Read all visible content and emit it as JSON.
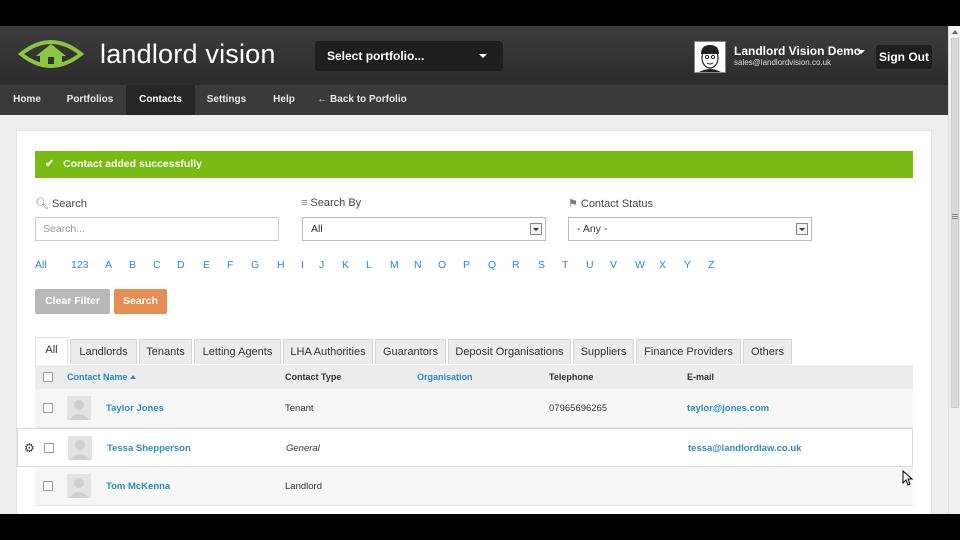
{
  "header": {
    "app_name": "landlord vision",
    "portfolio_select": "Select portfolio...",
    "user_name": "Landlord Vision Demo",
    "user_email": "sales@landlordvision.co.uk",
    "signout_label": "Sign Out"
  },
  "nav": {
    "items": [
      {
        "label": "Home"
      },
      {
        "label": "Portfolios"
      },
      {
        "label": "Contacts",
        "active": true
      },
      {
        "label": "Settings"
      },
      {
        "label": "Help"
      },
      {
        "label": "← Back to Porfolio"
      }
    ]
  },
  "alert": {
    "message": "Contact added successfully"
  },
  "filters": {
    "search_label": "Search",
    "search_placeholder": "Search...",
    "search_by_label": "Search By",
    "search_by_value": "All",
    "status_label": "Contact Status",
    "status_value": "- Any -"
  },
  "alphabet": [
    "All",
    "123",
    "A",
    "B",
    "C",
    "D",
    "E",
    "F",
    "G",
    "H",
    "I",
    "J",
    "K",
    "L",
    "M",
    "N",
    "O",
    "P",
    "Q",
    "R",
    "S",
    "T",
    "U",
    "V",
    "W",
    "X",
    "Y",
    "Z"
  ],
  "buttons": {
    "clear_filter": "Clear Filter",
    "search": "Search"
  },
  "tabs": [
    "All",
    "Landlords",
    "Tenants",
    "Letting Agents",
    "LHA Authorities",
    "Guarantors",
    "Deposit Organisations",
    "Suppliers",
    "Finance Providers",
    "Others"
  ],
  "table": {
    "columns": [
      "Contact Name",
      "Contact Type",
      "Organisation",
      "Telephone",
      "E-mail"
    ],
    "rows": [
      {
        "name": "Taylor Jones",
        "type": "Tenant",
        "telephone": "07965696265",
        "email": "taylor@jones.com"
      },
      {
        "name": "Tessa Shepperson",
        "type": "General",
        "telephone": "",
        "email": "tessa@landlordlaw.co.uk"
      },
      {
        "name": "Tom McKenna",
        "type": "Landlord",
        "telephone": "",
        "email": ""
      }
    ]
  },
  "colors": {
    "accent_green": "#78bb12",
    "link_blue": "#2a8ac6",
    "search_orange": "#e68e51",
    "header_dark": "#333333"
  }
}
